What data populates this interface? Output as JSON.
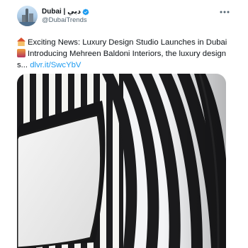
{
  "tweet": {
    "display_name": "Dubai | دبي",
    "handle": "@DubaiTrends",
    "line1": "Exciting News: Luxury Design Studio Launches in Dubai!",
    "line2": "Introducing Mehreen Baldoni Interiors, the luxury design",
    "line3_text": "s...",
    "link": "dlvr.it/SwcYbV"
  },
  "icons": {
    "verified": "verified-badge-icon",
    "more": "more-options-icon",
    "emoji1": "house-emoji",
    "emoji2": "city-emoji"
  },
  "colors": {
    "link": "#1d9bf0",
    "verified": "#1d9bf0",
    "handle": "#536471",
    "text": "#0f1419"
  }
}
